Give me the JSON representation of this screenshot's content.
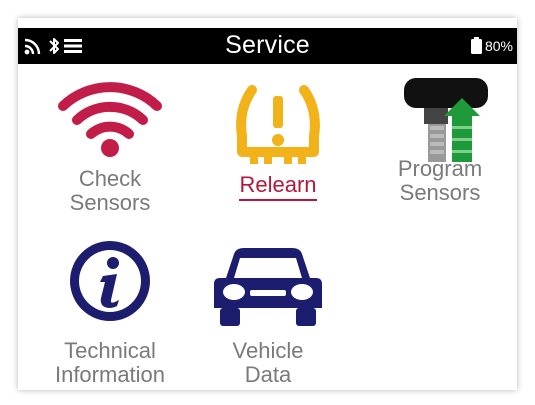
{
  "status_bar": {
    "title": "Service",
    "battery_text": "80%",
    "icons": [
      "wifi-icon",
      "bluetooth-icon",
      "menu-icon",
      "battery-icon"
    ]
  },
  "tiles": [
    {
      "name": "check-sensors",
      "label_lines": [
        "Check",
        "Sensors"
      ],
      "icon": "wifi-signal-icon",
      "selected": false
    },
    {
      "name": "relearn",
      "label_lines": [
        "Relearn"
      ],
      "icon": "tpms-warning-icon",
      "selected": true
    },
    {
      "name": "program-sensors",
      "label_lines": [
        "Program",
        "Sensors"
      ],
      "icon": "sensor-program-icon",
      "selected": false
    },
    {
      "name": "technical-information",
      "label_lines": [
        "Technical",
        "Information"
      ],
      "icon": "info-icon",
      "selected": false
    },
    {
      "name": "vehicle-data",
      "label_lines": [
        "Vehicle",
        "Data"
      ],
      "icon": "car-icon",
      "selected": false
    }
  ],
  "colors": {
    "accent": "#b5163a",
    "label": "#7a7a7a",
    "tpms_yellow": "#f2b21a",
    "navy": "#1c1d6e",
    "green": "#1f9a3a"
  }
}
